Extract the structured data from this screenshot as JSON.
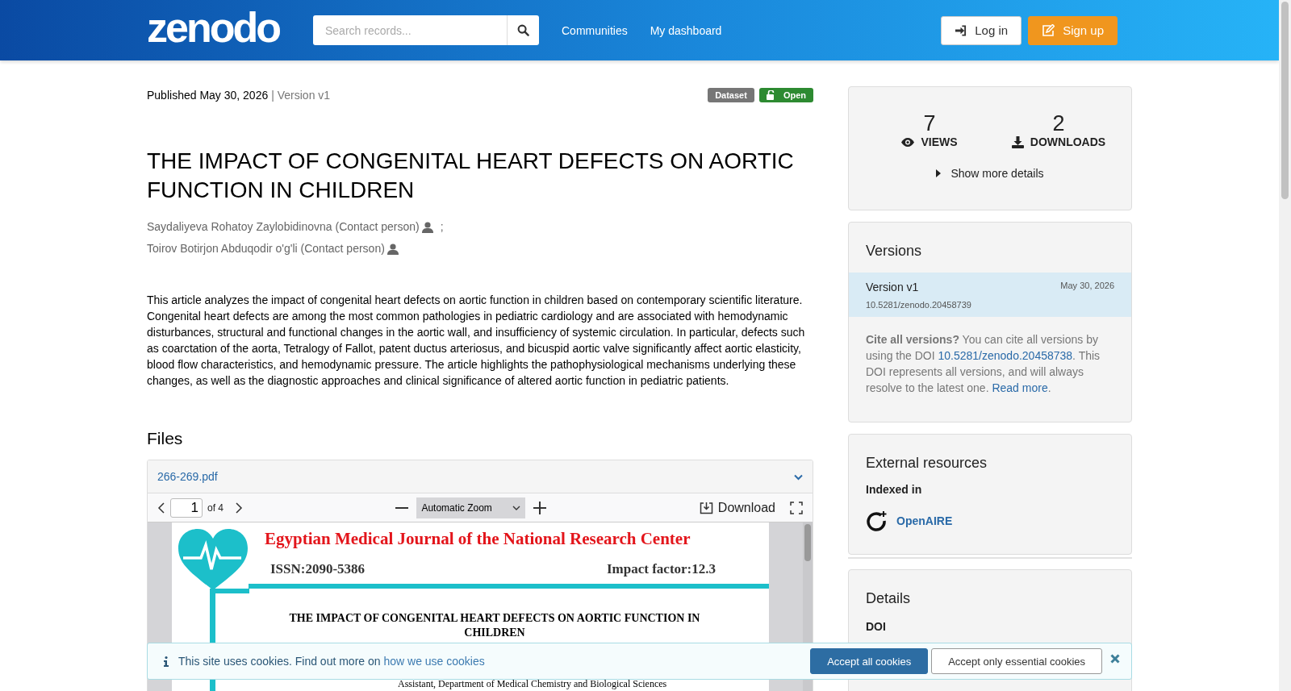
{
  "header": {
    "logo": "zenodo",
    "search": {
      "placeholder": "Search records..."
    },
    "nav": [
      "Communities",
      "My dashboard"
    ],
    "buttons": [
      {
        "kind": "login",
        "label": "Log in"
      },
      {
        "kind": "signup",
        "label": "Sign up"
      }
    ]
  },
  "record": {
    "published": "Published May 30, 2026",
    "version": "| Version v1",
    "badges": [
      {
        "kind": "type",
        "label": "Dataset"
      },
      {
        "kind": "access",
        "label": "Open"
      }
    ],
    "title": "THE IMPACT OF CONGENITAL HEART DEFECTS ON AORTIC FUNCTION IN CHILDREN",
    "authors": [
      {
        "name": "Saydaliyeva Rohatoy Zaylobidinovna (Contact person)",
        "separator": ";"
      },
      {
        "name": "Toirov Botirjon Abduqodir o'g'li (Contact person)"
      }
    ],
    "abstract": "This article analyzes the impact of congenital heart defects on aortic function in children based on contemporary scientific literature. Congenital heart defects are among the most common pathologies in pediatric cardiology and are associated with hemodynamic disturbances, structural and functional changes in the aortic wall, and insufficiency of systemic circulation. In particular, defects such as coarctation of the aorta, Tetralogy of Fallot, patent ductus arteriosus, and bicuspid aortic valve significantly affect aortic elasticity, blood flow characteristics, and hemodynamic pressure. The article highlights the pathophysiological mechanisms underlying these changes, as well as the diagnostic approaches and clinical significance of altered aortic function in pediatric patients.",
    "files": {
      "heading": "Files",
      "file_name": "266-269.pdf",
      "expanded": true,
      "viewer": {
        "page": "1",
        "page_count": "of 4",
        "zoom": "Automatic Zoom",
        "download": "Download",
        "document": {
          "journal": "Egyptian Medical Journal of the National Research Center",
          "issn": "ISSN:2090-5386",
          "impact": "Impact factor:12.3",
          "title": "THE IMPACT OF CONGENITAL HEART DEFECTS ON AORTIC FUNCTION IN CHILDREN",
          "affiliation": "Assistant, Department of Medical Chemistry and Biological Sciences"
        }
      }
    }
  },
  "sidebar": {
    "stats": [
      {
        "kind": "views",
        "value": "7",
        "label": "VIEWS"
      },
      {
        "kind": "downloads",
        "value": "2",
        "label": "DOWNLOADS"
      }
    ],
    "more_details": "Show more details",
    "versions": {
      "heading": "Versions",
      "items": [
        {
          "label": "Version v1",
          "date": "May 30, 2026",
          "doi": "10.5281/zenodo.20458739",
          "selected": true
        }
      ],
      "cite_text": "**Cite all versions?** You can cite all versions by using the DOI ",
      "cite_doi": "10.5281/zenodo.20458738",
      "cite_after": ". This DOI represents all versions, and will always resolve to the latest one. ",
      "read_more": "Read more",
      "cite_end": "."
    },
    "external": {
      "heading": "External resources",
      "subheading": "Indexed in",
      "items": [
        "OpenAIRE"
      ]
    },
    "details": {
      "heading": "Details",
      "fields": [
        "DOI"
      ]
    }
  },
  "cookie_bar": {
    "text": "This site uses cookies. Find out more on ",
    "link": "how we use cookies",
    "buttons": [
      {
        "kind": "primary",
        "label": "Accept all cookies"
      },
      {
        "kind": "secondary",
        "label": "Accept only essential cookies"
      }
    ]
  }
}
